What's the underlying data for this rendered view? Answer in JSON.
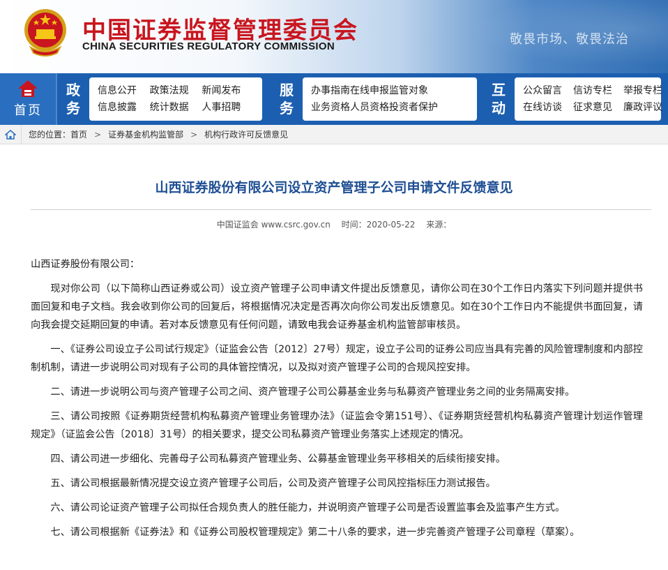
{
  "header": {
    "cn_title": "中国证券监督管理委员会",
    "en_title": "CHINA SECURITIES REGULATORY COMMISSION",
    "slogan": "敬畏市场、敬畏法治",
    "emblem_icon": "national-emblem-icon"
  },
  "nav": {
    "home_label": "首页",
    "home_icon": "csrc-logo-icon",
    "cat_zheng": [
      "政",
      "务"
    ],
    "zheng_links": [
      "信息公开",
      "政策法规",
      "新闻发布",
      "信息披露",
      "统计数据",
      "人事招聘"
    ],
    "cat_fu": [
      "服",
      "务"
    ],
    "fu_links": [
      "办事指南在线申报监管对象",
      "业务资格人员资格投资者保护"
    ],
    "cat_hu": [
      "互",
      "动"
    ],
    "hu_links": [
      "公众留言",
      "信访专栏",
      "举报专栏",
      "在线访谈",
      "征求意见",
      "廉政评议"
    ]
  },
  "breadcrumb": {
    "home_icon": "house-icon",
    "prefix": "您的位置：",
    "items": [
      "首页",
      "证券基金机构监管部",
      "机构行政许可反馈意见"
    ],
    "separator": ">"
  },
  "article": {
    "title": "山西证券股份有限公司设立资产管理子公司申请文件反馈意见",
    "source": "中国证监会 www.csrc.gov.cn",
    "time": "时间：2020-05-22",
    "origin": "来源：",
    "salutation": "山西证券股份有限公司：",
    "paragraphs": [
      "现对你公司（以下简称山西证券或公司）设立资产管理子公司申请文件提出反馈意见，请你公司在30个工作日内落实下列问题并提供书面回复和电子文档。我会收到你公司的回复后，将根据情况决定是否再次向你公司发出反馈意见。如在30个工作日内不能提供书面回复，请向我会提交延期回复的申请。若对本反馈意见有任何问题，请致电我会证券基金机构监管部审核员。",
      "一、《证券公司设立子公司试行规定》（证监会公告〔2012〕27号）规定，设立子公司的证券公司应当具有完善的风险管理制度和内部控制机制，请进一步说明公司对现有子公司的具体管控情况，以及拟对资产管理子公司的合规风控安排。",
      "二、请进一步说明公司与资产管理子公司之间、资产管理子公司公募基金业务与私募资产管理业务之间的业务隔离安排。",
      "三、请公司按照《证券期货经营机构私募资产管理业务管理办法》（证监会令第151号）、《证券期货经营机构私募资产管理计划运作管理规定》（证监会公告〔2018〕31号）的相关要求，提交公司私募资产管理业务落实上述规定的情况。",
      "四、请公司进一步细化、完善母子公司私募资产管理业务、公募基金管理业务平移相关的后续衔接安排。",
      "五、请公司根据最新情况提交设立资产管理子公司后，公司及资产管理子公司风控指标压力测试报告。",
      "六、请公司论证资产管理子公司拟任合规负责人的胜任能力，并说明资产管理子公司是否设置监事会及监事产生方式。",
      "七、请公司根据新《证券法》和《证券公司股权管理规定》第二十八条的要求，进一步完善资产管理子公司章程（草案）。"
    ]
  },
  "colors": {
    "brand_red": "#c9151e",
    "nav_blue": "#1c5fb0",
    "title_blue": "#1e4e93"
  }
}
